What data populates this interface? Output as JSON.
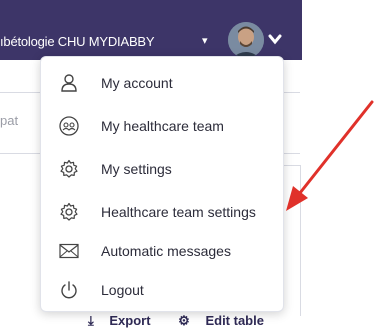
{
  "header": {
    "service_label": "ıbétologie CHU MYDIABBY",
    "service_caret": "▾",
    "avatar_caret": "❯"
  },
  "subbar": {
    "partial_text": "pat"
  },
  "menu": {
    "items": [
      {
        "label": "My account",
        "icon": "user-icon"
      },
      {
        "label": "My healthcare team",
        "icon": "team-icon"
      },
      {
        "label": "My settings",
        "icon": "gear-icon"
      },
      {
        "label": "Healthcare team settings",
        "icon": "gear-icon"
      },
      {
        "label": "Automatic messages",
        "icon": "envelope-icon"
      },
      {
        "label": "Logout",
        "icon": "power-icon"
      }
    ]
  },
  "actions": {
    "export_label": "Export",
    "edit_table_label": "Edit table"
  },
  "colors": {
    "topbar": "#3d3568",
    "annotation_arrow": "#e0312a",
    "menu_text": "#2c2c3a"
  }
}
